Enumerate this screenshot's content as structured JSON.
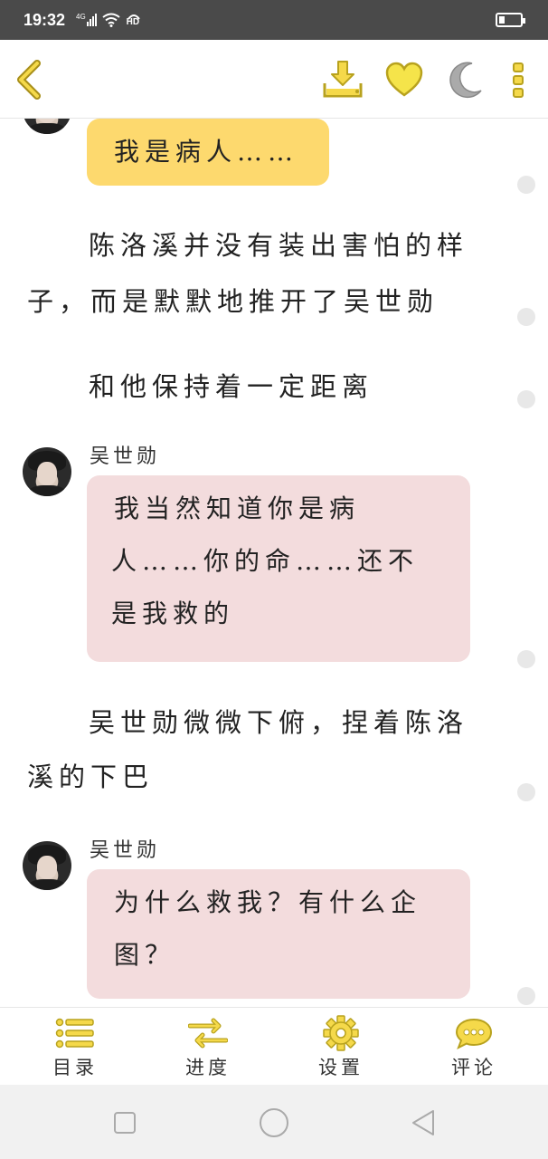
{
  "status_bar": {
    "time": "19:32",
    "network": "4G",
    "hd": "HD",
    "battery_level": 0.25
  },
  "toolbar": {
    "back_icon": "chevron-left-icon",
    "actions": [
      {
        "name": "download-icon",
        "label": ""
      },
      {
        "name": "heart-icon",
        "label": ""
      },
      {
        "name": "moon-icon",
        "label": ""
      },
      {
        "name": "more-vertical-icon",
        "label": ""
      }
    ]
  },
  "story": {
    "first_bubble": {
      "text": "我是病人……",
      "color": "#fdd96e"
    },
    "narration_1": {
      "line1": "陈洛溪并没有装出害怕的样",
      "line2": "子，而是默默地推开了吴世勋"
    },
    "narration_2": {
      "line1": "和他保持着一定距离"
    },
    "dialog_1": {
      "speaker": "吴世勋",
      "line1": "我当然知道你是病",
      "line2": "人……你的命……还不",
      "line3": "是我救的",
      "color": "#f3dcdd"
    },
    "narration_3": {
      "line1": "吴世勋微微下俯，捏着陈洛",
      "line2": "溪的下巴"
    },
    "dialog_2": {
      "speaker": "吴世勋",
      "line1": "为什么救我？有什么企",
      "line2": "图？",
      "color": "#f3dcdd"
    }
  },
  "bottom_nav": {
    "items": [
      {
        "label": "目录",
        "icon": "list-icon"
      },
      {
        "label": "进度",
        "icon": "swap-arrows-icon"
      },
      {
        "label": "设置",
        "icon": "gear-icon"
      },
      {
        "label": "评论",
        "icon": "comment-icon"
      }
    ]
  },
  "colors": {
    "accent_yellow": "#f5d94a",
    "icon_outline": "#b8a21e",
    "moon_gray": "#aaaaaa"
  }
}
